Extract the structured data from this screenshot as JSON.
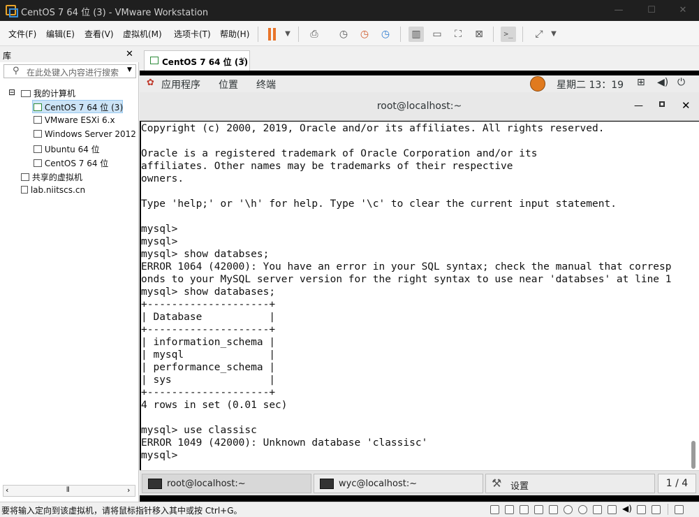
{
  "app": {
    "title": "CentOS 7 64 位 (3) - VMware Workstation"
  },
  "window_controls": {
    "minimize": "—",
    "maximize": "☐",
    "close": "✕"
  },
  "menu": [
    "文件(F)",
    "编辑(E)",
    "查看(V)",
    "虚拟机(M)",
    "选项卡(T)",
    "帮助(H)"
  ],
  "library": {
    "header": "库",
    "close": "✕",
    "search_placeholder": "在此处键入内容进行搜索",
    "my_computer": "我的计算机",
    "vms": [
      "CentOS 7 64 位 (3)",
      "VMware ESXi 6.x",
      "Windows Server 2012",
      "Ubuntu 64 位",
      "CentOS 7 64 位"
    ],
    "shared": "共享的虚拟机",
    "remote": "lab.niitscs.cn",
    "selected": "CentOS 7 64 位 (3)"
  },
  "tab": {
    "label": "CentOS 7 64 位 (3)",
    "close": "✕"
  },
  "gnome": {
    "applications": "应用程序",
    "places": "位置",
    "terminal": "终端",
    "clock": "星期二 13：19"
  },
  "terminal": {
    "title": "root@localhost:~",
    "lines": [
      "Copyright (c) 2000, 2019, Oracle and/or its affiliates. All rights reserved.",
      "",
      "Oracle is a registered trademark of Oracle Corporation and/or its",
      "affiliates. Other names may be trademarks of their respective",
      "owners.",
      "",
      "Type 'help;' or '\\h' for help. Type '\\c' to clear the current input statement.",
      "",
      "mysql>",
      "mysql>",
      "mysql> show databses;",
      "ERROR 1064 (42000): You have an error in your SQL syntax; check the manual that corresp",
      "onds to your MySQL server version for the right syntax to use near 'databses' at line 1",
      "mysql> show databases;",
      "+--------------------+",
      "| Database           |",
      "+--------------------+",
      "| information_schema |",
      "| mysql              |",
      "| performance_schema |",
      "| sys                |",
      "+--------------------+",
      "4 rows in set (0.01 sec)",
      "",
      "mysql> use classisc",
      "ERROR 1049 (42000): Unknown database 'classisc'",
      "mysql>"
    ]
  },
  "taskbar": {
    "items": [
      "root@localhost:~",
      "wyc@localhost:~",
      "设置"
    ],
    "pager": "1 / 4"
  },
  "status": {
    "message": "要将输入定向到该虚拟机，请将鼠标指针移入其中或按 Ctrl+G。"
  },
  "colors": {
    "titlebar": "#1f1f1f",
    "accent_pause": "#e8742a",
    "terminal_bg": "#ffffff",
    "gnome_bar": "#ececec"
  }
}
